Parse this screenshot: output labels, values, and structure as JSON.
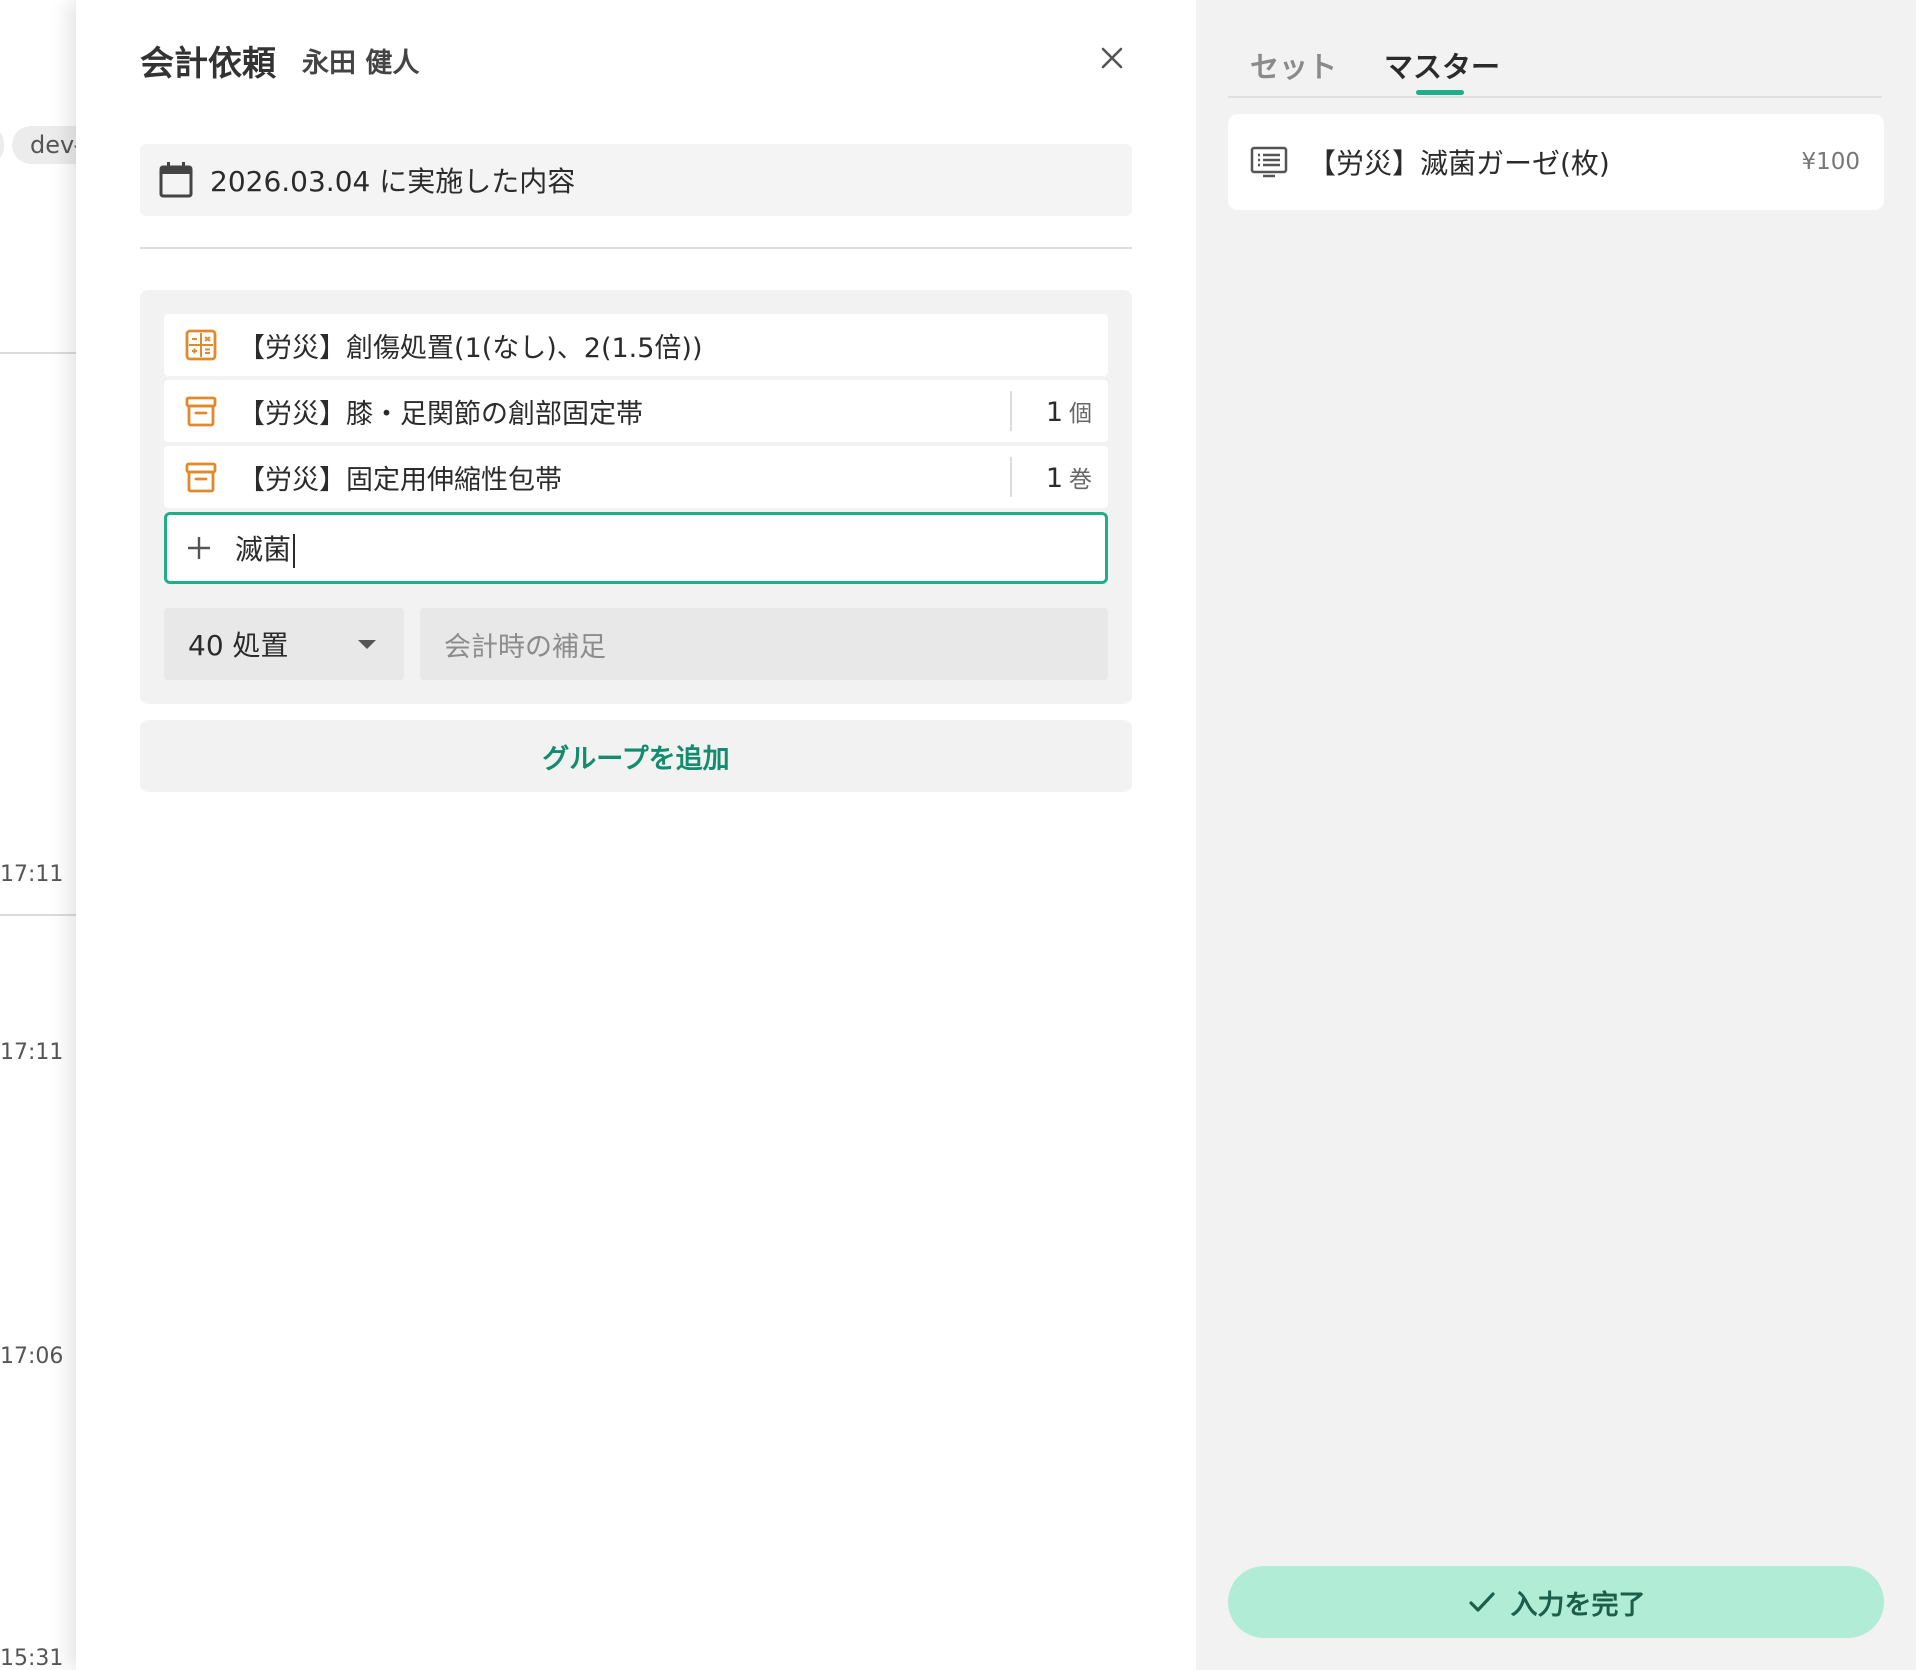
{
  "background": {
    "chip_label": "dev-",
    "times": [
      "17:11",
      "17:11",
      "17:06",
      "15:31"
    ]
  },
  "modal": {
    "title": "会計依頼",
    "patient_name": "永田 健人",
    "date_text": "2026.03.04 に実施した内容",
    "items": [
      {
        "icon": "calculator-icon",
        "label": "【労災】創傷処置(1(なし)、2(1.5倍))",
        "qty": "",
        "unit": ""
      },
      {
        "icon": "archive-box-icon",
        "label": "【労災】膝・足関節の創部固定帯",
        "qty": "1",
        "unit": "個"
      },
      {
        "icon": "archive-box-icon",
        "label": "【労災】固定用伸縮性包帯",
        "qty": "1",
        "unit": "巻"
      }
    ],
    "add_input_value": "滅菌",
    "category_select": "40 処置",
    "note_placeholder": "会計時の補足",
    "add_group_label": "グループを追加"
  },
  "side_panel": {
    "tabs": [
      {
        "label": "セット",
        "active": false
      },
      {
        "label": "マスター",
        "active": true
      }
    ],
    "results": [
      {
        "icon": "list-card-icon",
        "label": "【労災】滅菌ガーゼ(枚)",
        "price": "¥100"
      }
    ],
    "complete_label": "入力を完了"
  },
  "colors": {
    "accent": "#1fae88",
    "accent_text": "#128c6c",
    "item_icon": "#e08a2c",
    "complete_bg": "#b1ecd7"
  }
}
